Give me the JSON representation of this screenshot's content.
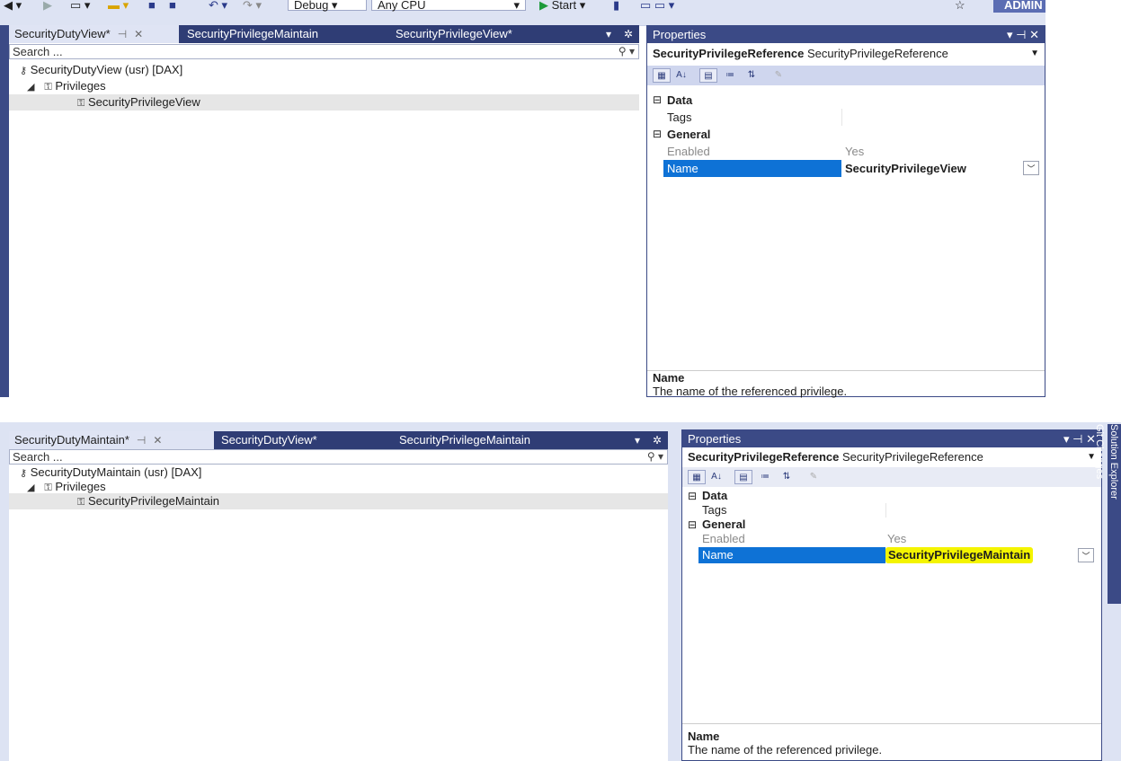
{
  "toolbar": {
    "debug": "Debug",
    "cpu": "Any CPU",
    "start": "Start",
    "user": "ADMIN"
  },
  "top": {
    "tabs": [
      {
        "label": "SecurityDutyView*"
      },
      {
        "label": "SecurityPrivilegeMaintain"
      },
      {
        "label": "SecurityPrivilegeView*"
      }
    ],
    "search_placeholder": "Search ...",
    "tree": {
      "root": "SecurityDutyView (usr) [DAX]",
      "group": "Privileges",
      "leaf": "SecurityPrivilegeView"
    },
    "props": {
      "title": "Properties",
      "object_type": "SecurityPrivilegeReference",
      "object_name": "SecurityPrivilegeReference",
      "cat_data": "Data",
      "tags_label": "Tags",
      "tags_value": "",
      "cat_general": "General",
      "enabled_label": "Enabled",
      "enabled_value": "Yes",
      "name_label": "Name",
      "name_value": "SecurityPrivilegeView",
      "desc_title": "Name",
      "desc_text": "The name of the referenced privilege."
    }
  },
  "bottom": {
    "tabs": [
      {
        "label": "SecurityDutyMaintain*"
      },
      {
        "label": "SecurityDutyView*"
      },
      {
        "label": "SecurityPrivilegeMaintain"
      }
    ],
    "search_placeholder": "Search ...",
    "tree": {
      "root": "SecurityDutyMaintain (usr) [DAX]",
      "group": "Privileges",
      "leaf": "SecurityPrivilegeMaintain"
    },
    "props": {
      "title": "Properties",
      "object_type": "SecurityPrivilegeReference",
      "object_name": "SecurityPrivilegeReference",
      "cat_data": "Data",
      "tags_label": "Tags",
      "tags_value": "",
      "cat_general": "General",
      "enabled_label": "Enabled",
      "enabled_value": "Yes",
      "name_label": "Name",
      "name_value": "SecurityPrivilegeMaintain",
      "desc_title": "Name",
      "desc_text": "The name of the referenced privilege."
    },
    "side_tabs": [
      "Solution Explorer",
      "Git Changes"
    ]
  }
}
